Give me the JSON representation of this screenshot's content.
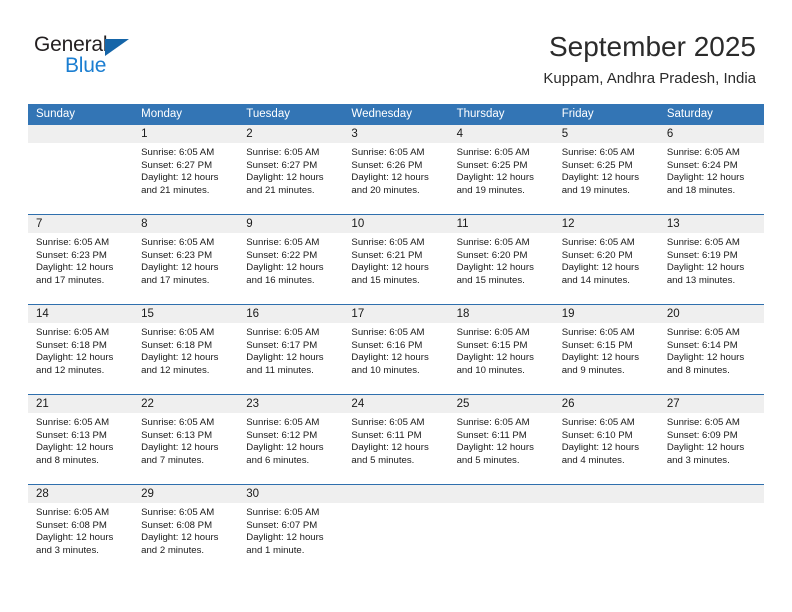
{
  "brand": {
    "name_part1": "General",
    "name_part2": "Blue",
    "triangle_color": "#1565a8",
    "blue_color": "#1b7ed1"
  },
  "header": {
    "title": "September 2025",
    "subtitle": "Kuppam, Andhra Pradesh, India"
  },
  "colors": {
    "header_row_background": "#3375b5",
    "header_row_text": "#ffffff",
    "daynum_band_background": "#efefef",
    "week_divider": "#2f6fad"
  },
  "weekday_headers": [
    "Sunday",
    "Monday",
    "Tuesday",
    "Wednesday",
    "Thursday",
    "Friday",
    "Saturday"
  ],
  "weeks": [
    [
      {
        "day": "",
        "empty": true,
        "sunrise": "",
        "sunset": "",
        "daylight_line1": "",
        "daylight_line2": ""
      },
      {
        "day": "1",
        "sunrise": "Sunrise: 6:05 AM",
        "sunset": "Sunset: 6:27 PM",
        "daylight_line1": "Daylight: 12 hours",
        "daylight_line2": "and 21 minutes."
      },
      {
        "day": "2",
        "sunrise": "Sunrise: 6:05 AM",
        "sunset": "Sunset: 6:27 PM",
        "daylight_line1": "Daylight: 12 hours",
        "daylight_line2": "and 21 minutes."
      },
      {
        "day": "3",
        "sunrise": "Sunrise: 6:05 AM",
        "sunset": "Sunset: 6:26 PM",
        "daylight_line1": "Daylight: 12 hours",
        "daylight_line2": "and 20 minutes."
      },
      {
        "day": "4",
        "sunrise": "Sunrise: 6:05 AM",
        "sunset": "Sunset: 6:25 PM",
        "daylight_line1": "Daylight: 12 hours",
        "daylight_line2": "and 19 minutes."
      },
      {
        "day": "5",
        "sunrise": "Sunrise: 6:05 AM",
        "sunset": "Sunset: 6:25 PM",
        "daylight_line1": "Daylight: 12 hours",
        "daylight_line2": "and 19 minutes."
      },
      {
        "day": "6",
        "sunrise": "Sunrise: 6:05 AM",
        "sunset": "Sunset: 6:24 PM",
        "daylight_line1": "Daylight: 12 hours",
        "daylight_line2": "and 18 minutes."
      }
    ],
    [
      {
        "day": "7",
        "sunrise": "Sunrise: 6:05 AM",
        "sunset": "Sunset: 6:23 PM",
        "daylight_line1": "Daylight: 12 hours",
        "daylight_line2": "and 17 minutes."
      },
      {
        "day": "8",
        "sunrise": "Sunrise: 6:05 AM",
        "sunset": "Sunset: 6:23 PM",
        "daylight_line1": "Daylight: 12 hours",
        "daylight_line2": "and 17 minutes."
      },
      {
        "day": "9",
        "sunrise": "Sunrise: 6:05 AM",
        "sunset": "Sunset: 6:22 PM",
        "daylight_line1": "Daylight: 12 hours",
        "daylight_line2": "and 16 minutes."
      },
      {
        "day": "10",
        "sunrise": "Sunrise: 6:05 AM",
        "sunset": "Sunset: 6:21 PM",
        "daylight_line1": "Daylight: 12 hours",
        "daylight_line2": "and 15 minutes."
      },
      {
        "day": "11",
        "sunrise": "Sunrise: 6:05 AM",
        "sunset": "Sunset: 6:20 PM",
        "daylight_line1": "Daylight: 12 hours",
        "daylight_line2": "and 15 minutes."
      },
      {
        "day": "12",
        "sunrise": "Sunrise: 6:05 AM",
        "sunset": "Sunset: 6:20 PM",
        "daylight_line1": "Daylight: 12 hours",
        "daylight_line2": "and 14 minutes."
      },
      {
        "day": "13",
        "sunrise": "Sunrise: 6:05 AM",
        "sunset": "Sunset: 6:19 PM",
        "daylight_line1": "Daylight: 12 hours",
        "daylight_line2": "and 13 minutes."
      }
    ],
    [
      {
        "day": "14",
        "sunrise": "Sunrise: 6:05 AM",
        "sunset": "Sunset: 6:18 PM",
        "daylight_line1": "Daylight: 12 hours",
        "daylight_line2": "and 12 minutes."
      },
      {
        "day": "15",
        "sunrise": "Sunrise: 6:05 AM",
        "sunset": "Sunset: 6:18 PM",
        "daylight_line1": "Daylight: 12 hours",
        "daylight_line2": "and 12 minutes."
      },
      {
        "day": "16",
        "sunrise": "Sunrise: 6:05 AM",
        "sunset": "Sunset: 6:17 PM",
        "daylight_line1": "Daylight: 12 hours",
        "daylight_line2": "and 11 minutes."
      },
      {
        "day": "17",
        "sunrise": "Sunrise: 6:05 AM",
        "sunset": "Sunset: 6:16 PM",
        "daylight_line1": "Daylight: 12 hours",
        "daylight_line2": "and 10 minutes."
      },
      {
        "day": "18",
        "sunrise": "Sunrise: 6:05 AM",
        "sunset": "Sunset: 6:15 PM",
        "daylight_line1": "Daylight: 12 hours",
        "daylight_line2": "and 10 minutes."
      },
      {
        "day": "19",
        "sunrise": "Sunrise: 6:05 AM",
        "sunset": "Sunset: 6:15 PM",
        "daylight_line1": "Daylight: 12 hours",
        "daylight_line2": "and 9 minutes."
      },
      {
        "day": "20",
        "sunrise": "Sunrise: 6:05 AM",
        "sunset": "Sunset: 6:14 PM",
        "daylight_line1": "Daylight: 12 hours",
        "daylight_line2": "and 8 minutes."
      }
    ],
    [
      {
        "day": "21",
        "sunrise": "Sunrise: 6:05 AM",
        "sunset": "Sunset: 6:13 PM",
        "daylight_line1": "Daylight: 12 hours",
        "daylight_line2": "and 8 minutes."
      },
      {
        "day": "22",
        "sunrise": "Sunrise: 6:05 AM",
        "sunset": "Sunset: 6:13 PM",
        "daylight_line1": "Daylight: 12 hours",
        "daylight_line2": "and 7 minutes."
      },
      {
        "day": "23",
        "sunrise": "Sunrise: 6:05 AM",
        "sunset": "Sunset: 6:12 PM",
        "daylight_line1": "Daylight: 12 hours",
        "daylight_line2": "and 6 minutes."
      },
      {
        "day": "24",
        "sunrise": "Sunrise: 6:05 AM",
        "sunset": "Sunset: 6:11 PM",
        "daylight_line1": "Daylight: 12 hours",
        "daylight_line2": "and 5 minutes."
      },
      {
        "day": "25",
        "sunrise": "Sunrise: 6:05 AM",
        "sunset": "Sunset: 6:11 PM",
        "daylight_line1": "Daylight: 12 hours",
        "daylight_line2": "and 5 minutes."
      },
      {
        "day": "26",
        "sunrise": "Sunrise: 6:05 AM",
        "sunset": "Sunset: 6:10 PM",
        "daylight_line1": "Daylight: 12 hours",
        "daylight_line2": "and 4 minutes."
      },
      {
        "day": "27",
        "sunrise": "Sunrise: 6:05 AM",
        "sunset": "Sunset: 6:09 PM",
        "daylight_line1": "Daylight: 12 hours",
        "daylight_line2": "and 3 minutes."
      }
    ],
    [
      {
        "day": "28",
        "sunrise": "Sunrise: 6:05 AM",
        "sunset": "Sunset: 6:08 PM",
        "daylight_line1": "Daylight: 12 hours",
        "daylight_line2": "and 3 minutes."
      },
      {
        "day": "29",
        "sunrise": "Sunrise: 6:05 AM",
        "sunset": "Sunset: 6:08 PM",
        "daylight_line1": "Daylight: 12 hours",
        "daylight_line2": "and 2 minutes."
      },
      {
        "day": "30",
        "sunrise": "Sunrise: 6:05 AM",
        "sunset": "Sunset: 6:07 PM",
        "daylight_line1": "Daylight: 12 hours",
        "daylight_line2": "and 1 minute."
      },
      {
        "day": "",
        "empty": true,
        "sunrise": "",
        "sunset": "",
        "daylight_line1": "",
        "daylight_line2": ""
      },
      {
        "day": "",
        "empty": true,
        "sunrise": "",
        "sunset": "",
        "daylight_line1": "",
        "daylight_line2": ""
      },
      {
        "day": "",
        "empty": true,
        "sunrise": "",
        "sunset": "",
        "daylight_line1": "",
        "daylight_line2": ""
      },
      {
        "day": "",
        "empty": true,
        "sunrise": "",
        "sunset": "",
        "daylight_line1": "",
        "daylight_line2": ""
      }
    ]
  ]
}
